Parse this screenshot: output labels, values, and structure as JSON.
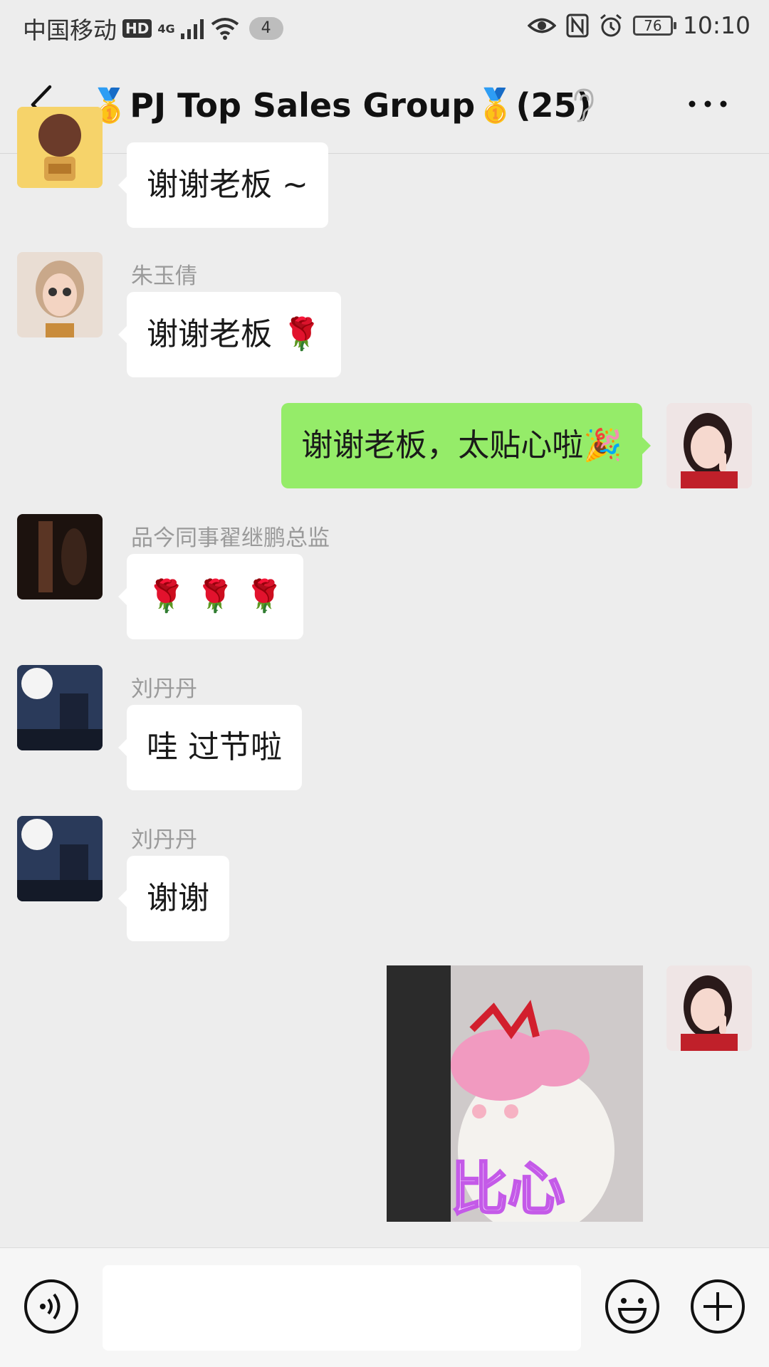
{
  "status_bar": {
    "carrier": "中国移动",
    "hd": "HD",
    "network": "4G",
    "notif_count": "4",
    "battery": "76",
    "time": "10:10"
  },
  "header": {
    "title": "🥇PJ Top Sales Group🥇(25)"
  },
  "messages": [
    {
      "side": "left",
      "sender": "",
      "text": "谢谢老板 ~"
    },
    {
      "side": "left",
      "sender": "朱玉倩",
      "text": "谢谢老板 🌹"
    },
    {
      "side": "right",
      "sender": "",
      "text": "谢谢老板，太贴心啦🎉"
    },
    {
      "side": "left",
      "sender": "品今同事翟继鹏总监",
      "text": "🌹 🌹 🌹"
    },
    {
      "side": "left",
      "sender": "刘丹丹",
      "text": "哇 过节啦"
    },
    {
      "side": "left",
      "sender": "刘丹丹",
      "text": "谢谢"
    },
    {
      "side": "right",
      "sender": "",
      "sticker_text": "比心"
    }
  ],
  "input": {
    "placeholder": ""
  },
  "colors": {
    "background": "#ededed",
    "bubble_self": "#95ec69",
    "bubble_other": "#ffffff"
  }
}
